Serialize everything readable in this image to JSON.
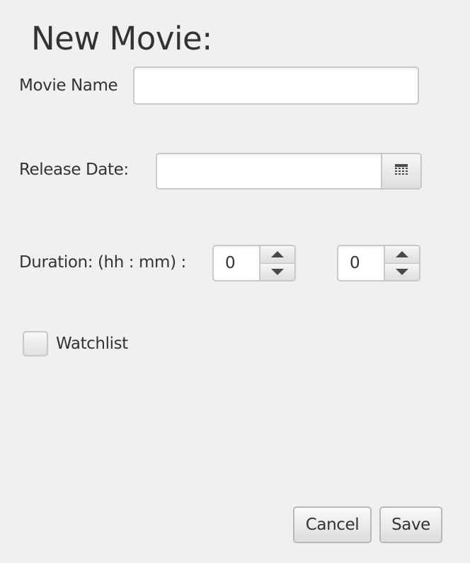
{
  "dialog": {
    "title": "New Movie:"
  },
  "form": {
    "movie_name": {
      "label": "Movie Name",
      "value": "",
      "placeholder": ""
    },
    "release_date": {
      "label": "Release Date:",
      "value": "",
      "placeholder": "",
      "icon": "calendar-icon"
    },
    "duration": {
      "label": "Duration: (hh : mm) :",
      "hours": "0",
      "minutes": "0"
    },
    "watchlist": {
      "label": "Watchlist",
      "checked": false
    }
  },
  "actions": {
    "cancel_label": "Cancel",
    "save_label": "Save"
  }
}
